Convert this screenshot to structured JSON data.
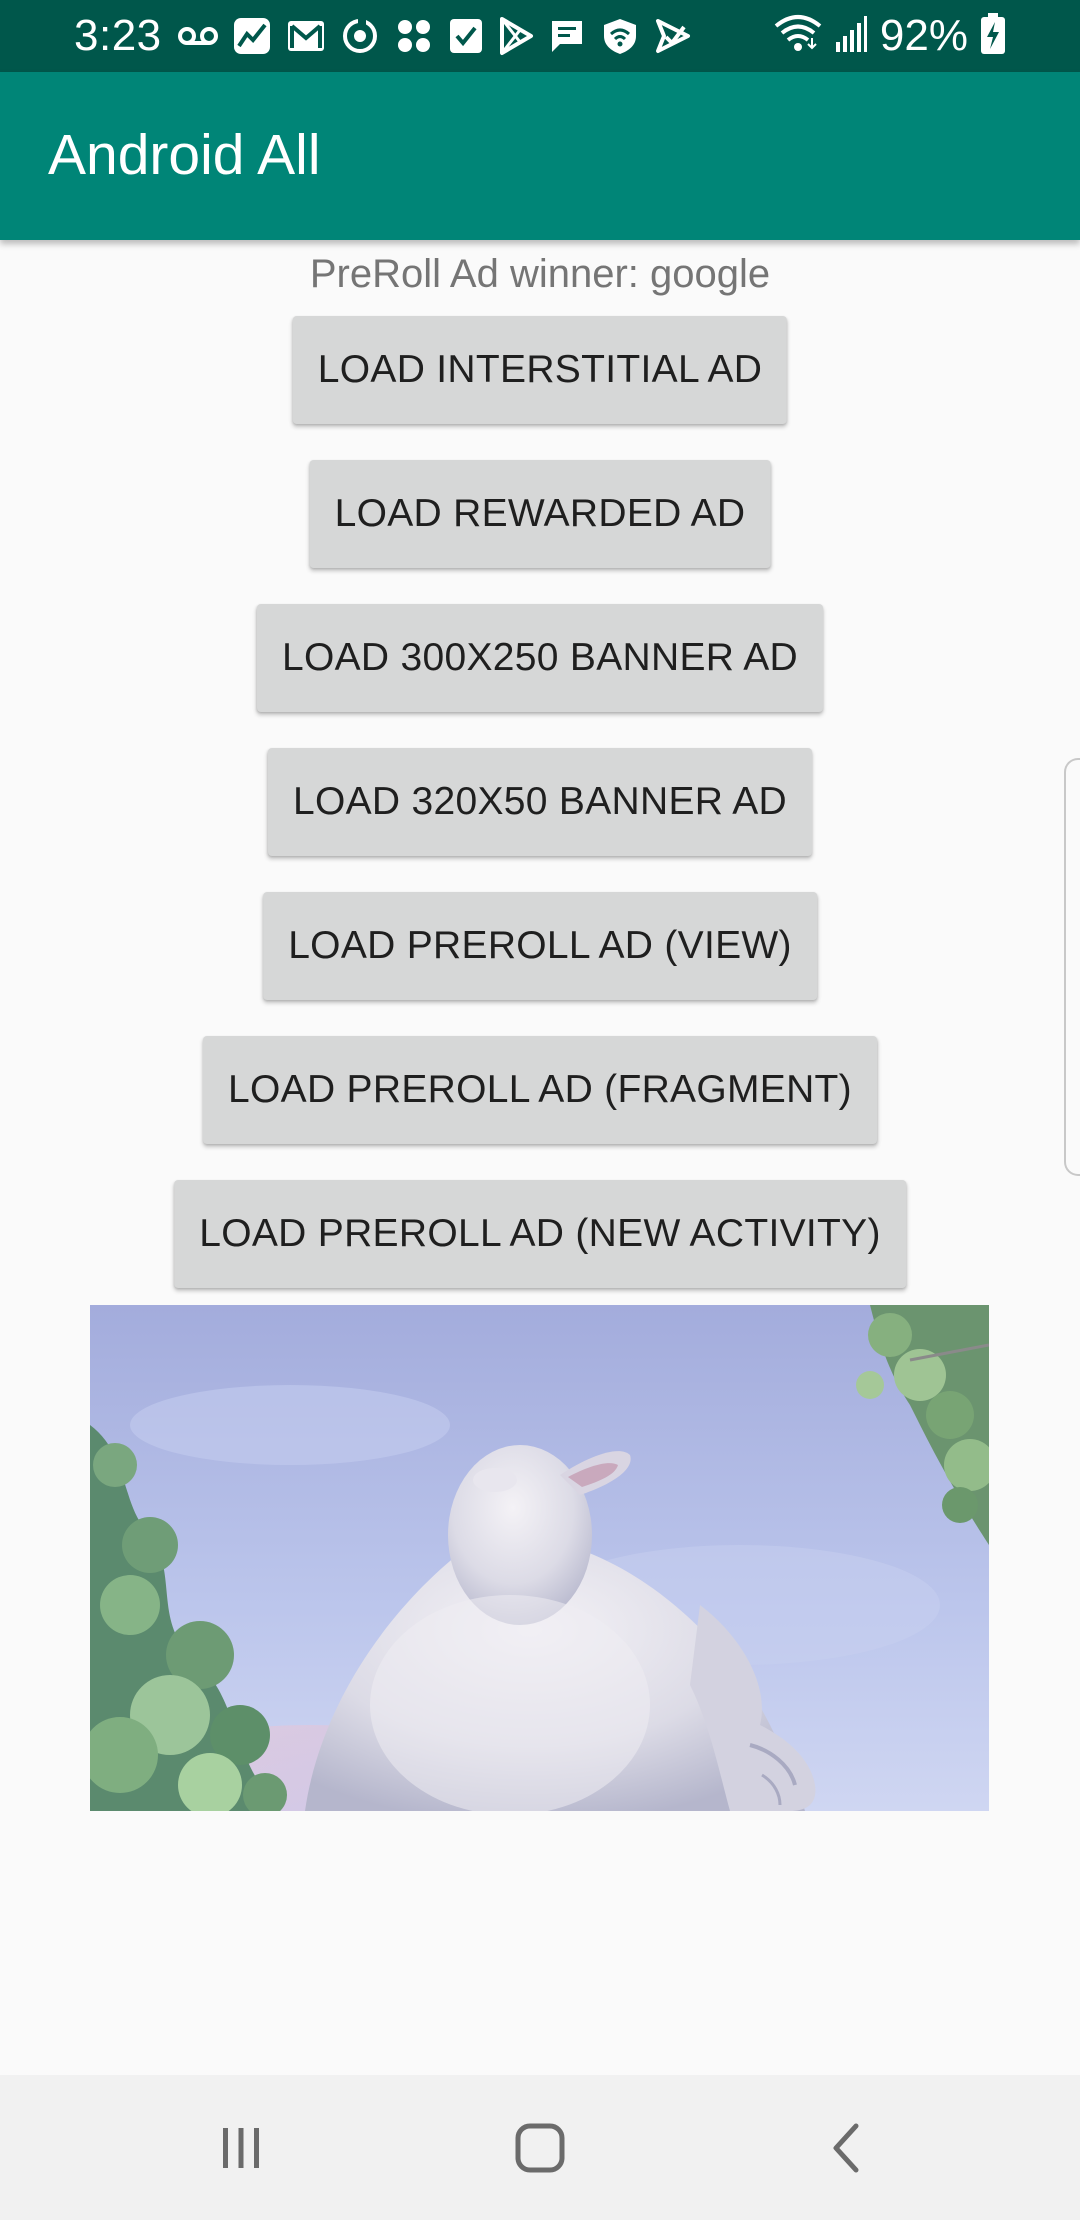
{
  "status_bar": {
    "time": "3:23",
    "battery_percent": "92%",
    "icons": [
      "voicemail-icon",
      "app-activity-icon",
      "gmail-icon",
      "sync-icon",
      "app-grid-icon",
      "checkbox-icon",
      "play-store-icon",
      "message-icon",
      "shield-wifi-icon",
      "send-icon",
      "wifi-icon",
      "signal-icon",
      "battery-charging-icon"
    ]
  },
  "app_bar": {
    "title": "Android All"
  },
  "content": {
    "winner_text": "PreRoll Ad winner: google",
    "buttons": [
      {
        "label": "LOAD INTERSTITIAL AD"
      },
      {
        "label": "LOAD REWARDED AD"
      },
      {
        "label": "LOAD 300X250 BANNER AD"
      },
      {
        "label": "LOAD 320X50 BANNER AD"
      },
      {
        "label": "LOAD PREROLL AD (VIEW)"
      },
      {
        "label": "LOAD PREROLL AD (FRAGMENT)"
      },
      {
        "label": "LOAD PREROLL AD (NEW ACTIVITY)"
      }
    ]
  },
  "nav_bar": {
    "buttons": [
      "recent-apps-icon",
      "home-icon",
      "back-icon"
    ]
  },
  "colors": {
    "status_bar": "#00574b",
    "app_bar": "#008577",
    "button_bg": "#d6d7d7",
    "background": "#fafafa"
  }
}
